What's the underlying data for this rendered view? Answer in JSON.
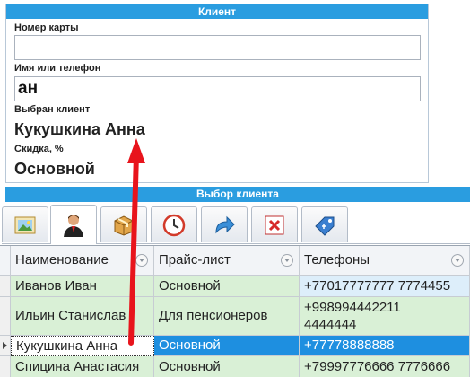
{
  "client_panel": {
    "title": "Клиент",
    "card_number_label": "Номер карты",
    "card_number_value": "",
    "name_phone_label": "Имя или телефон",
    "name_phone_value": "ан",
    "selected_client_label": "Выбран клиент",
    "selected_client_value": "Кукушкина Анна",
    "discount_label": "Скидка, %",
    "discount_value": "Основной"
  },
  "selection": {
    "title": "Выбор клиента",
    "tabs": [
      {
        "icon": "picture-icon",
        "active": false
      },
      {
        "icon": "person-icon",
        "active": true
      },
      {
        "icon": "box-icon",
        "active": false
      },
      {
        "icon": "clock-icon",
        "active": false
      },
      {
        "icon": "redo-arrow-icon",
        "active": false
      },
      {
        "icon": "delete-icon",
        "active": false
      },
      {
        "icon": "price-tag-icon",
        "active": false
      }
    ]
  },
  "grid": {
    "columns": [
      "Наименование",
      "Прайс-лист",
      "Телефоны"
    ],
    "rows": [
      {
        "name": "Иванов Иван",
        "price_list": "Основной",
        "phones": "+77017777777 7774455"
      },
      {
        "name": "Ильин Станислав",
        "price_list": "Для пенсионеров",
        "phones": "+998994442211",
        "phones_line2": "4444444"
      },
      {
        "name": "Кукушкина Анна",
        "price_list": "Основной",
        "phones": "+77778888888"
      },
      {
        "name": "Спицина Анастасия",
        "price_list": "Основной",
        "phones": "+79997776666 7776666"
      }
    ]
  },
  "colors": {
    "header_blue": "#2a9de0",
    "selection_blue": "#1e8fe0",
    "row_green": "#d9f0d6",
    "row_blue": "#ddeefa",
    "arrow_red": "#e8141c"
  }
}
